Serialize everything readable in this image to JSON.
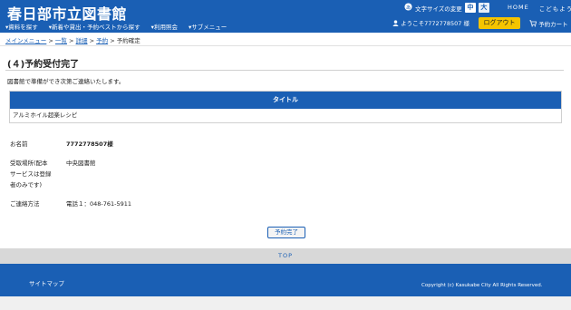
{
  "header": {
    "logo": "春日部市立図書館",
    "font_size_label": "文字サイズの変更",
    "font_size_medium": "中",
    "font_size_large": "大",
    "home_link": "HOME",
    "kids_link": "こどもよう",
    "nav_items": [
      "資料を探す",
      "新着や貸出・予約ベストから探す",
      "利用照会",
      "サブメニュー"
    ],
    "welcome_text": "ようこそ7772778507 様",
    "logout_label": "ログアウト",
    "cart_label": "予約カート"
  },
  "breadcrumb": {
    "items": [
      "メインメニュー",
      "一覧",
      "詳細",
      "予約"
    ],
    "current": "予約確定",
    "separator": ">"
  },
  "main": {
    "title": "(４)予約受付完了",
    "lead": "図書館で準備ができ次第ご連絡いたします。",
    "table_header": "タイトル",
    "table_rows": [
      "アルミホイル超楽レシピ"
    ],
    "info": {
      "name_label": "お名前",
      "name_value": "7772778507様",
      "pickup_label_1": "受取場所(配本",
      "pickup_label_2": "サービスは登録",
      "pickup_label_3": "者のみです)",
      "pickup_value": "中央図書館",
      "contact_label": "ご連絡方法",
      "contact_value": "電話１：048-761-5911"
    },
    "complete_button": "予約完了"
  },
  "footer": {
    "to_top": "TOP",
    "sitemap": "サイトマップ",
    "copyright": "Copyright (c) Kasukabe City All Rights Reserved."
  },
  "colors": {
    "brand": "#1a5fb4",
    "logout": "#f5c400"
  }
}
